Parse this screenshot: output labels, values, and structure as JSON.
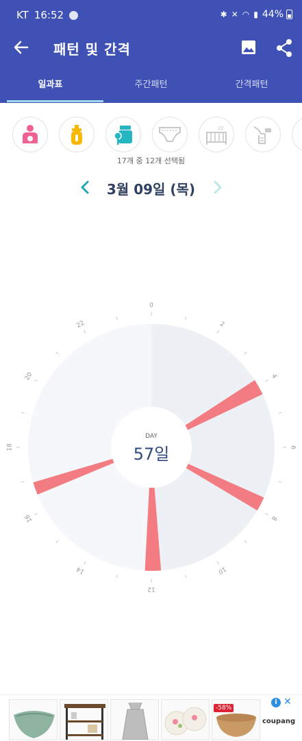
{
  "status_bar": {
    "carrier": "KT",
    "time": "16:52",
    "battery": "44%"
  },
  "appbar": {
    "title": "패턴 및 간격"
  },
  "tabs": [
    {
      "label": "일과표",
      "active": true
    },
    {
      "label": "주간패턴",
      "active": false
    },
    {
      "label": "간격패턴",
      "active": false
    }
  ],
  "categories": {
    "items": [
      {
        "icon": "breastfeeding-icon",
        "color": "#f06292"
      },
      {
        "icon": "baby-bottle-icon",
        "color": "#f9b800"
      },
      {
        "icon": "baby-food-icon",
        "color": "#26b5c3"
      },
      {
        "icon": "diaper-icon",
        "color": "#c9c9c9"
      },
      {
        "icon": "sleep-crib-icon",
        "color": "#c9c9c9"
      },
      {
        "icon": "breast-pump-icon",
        "color": "#c9c9c9"
      },
      {
        "icon": "more-category-icon",
        "color": "#f9d26b"
      }
    ],
    "selected_text": "17개 중 12개 선택됨"
  },
  "date_nav": {
    "date": "3월 09일 (목)"
  },
  "clock": {
    "center_label": "DAY",
    "center_value": "57일",
    "hour_labels": [
      "0",
      "2",
      "4",
      "6",
      "8",
      "10",
      "12",
      "14",
      "16",
      "18",
      "20",
      "22"
    ],
    "colors": {
      "day": "#edf1f6",
      "night": "#f5f7fa",
      "event": "#f27c81"
    },
    "events": [
      {
        "start_hour": 3.8,
        "end_hour": 4.3
      },
      {
        "start_hour": 7.6,
        "end_hour": 8.05
      },
      {
        "start_hour": 11.7,
        "end_hour": 12.2
      },
      {
        "start_hour": 16.5,
        "end_hour": 16.9
      }
    ]
  },
  "ad": {
    "discount": "-58%",
    "brand": "coupang"
  },
  "colors": {
    "primary": "#3f51b5",
    "tab_indicator": "#9fd8ef",
    "date_text": "#2f4060",
    "date_arrow": "#26a6b3"
  }
}
